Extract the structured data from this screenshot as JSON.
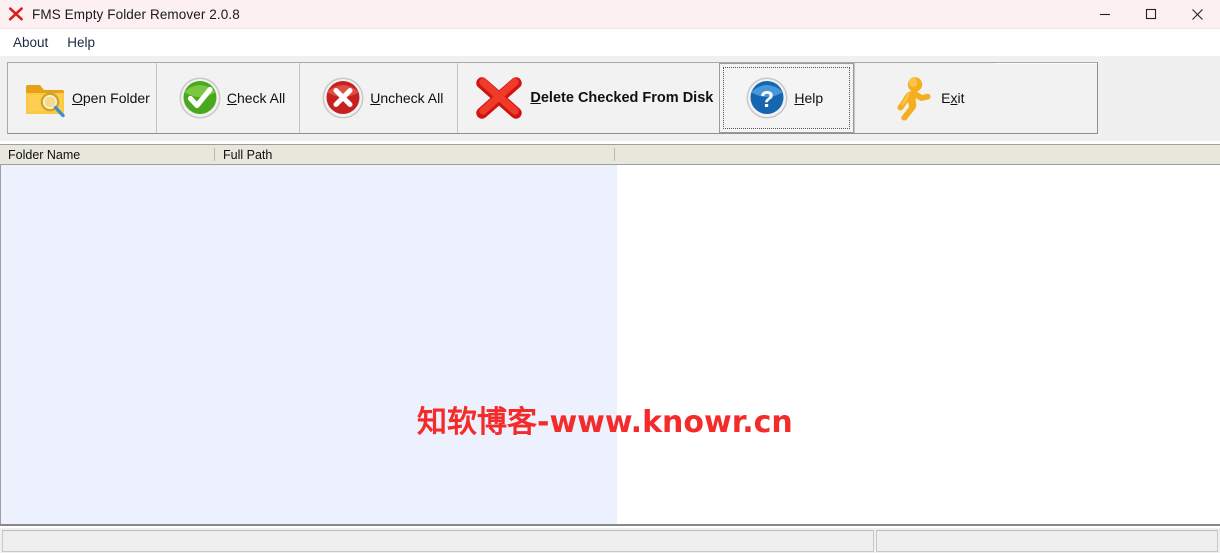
{
  "window": {
    "title": "FMS Empty Folder Remover 2.0.8",
    "icon": "red-x-icon",
    "titlebar_color": "#fcf0f2",
    "controls": [
      {
        "name": "minimize-button",
        "glyph": "minimize"
      },
      {
        "name": "maximize-button",
        "glyph": "maximize"
      },
      {
        "name": "close-button",
        "glyph": "close"
      }
    ]
  },
  "menubar": {
    "items": [
      {
        "label": "About",
        "name": "menu-item-about"
      },
      {
        "label": "Help",
        "name": "menu-item-help"
      }
    ]
  },
  "toolbar": {
    "buttons": [
      {
        "name": "open-folder-button",
        "icon": "folder-search-icon",
        "label_pre": "",
        "accel": "O",
        "label_post": "pen Folder",
        "bold": false,
        "focused": false
      },
      {
        "name": "check-all-button",
        "icon": "green-check-circle-icon",
        "label_pre": "",
        "accel": "C",
        "label_post": "heck All",
        "bold": false,
        "focused": false
      },
      {
        "name": "uncheck-all-button",
        "icon": "red-x-circle-icon",
        "label_pre": "",
        "accel": "U",
        "label_post": "ncheck All",
        "bold": false,
        "focused": false
      },
      {
        "name": "delete-checked-from-disk-button",
        "icon": "red-cross-icon",
        "label_pre": "",
        "accel": "D",
        "label_post": "elete Checked From Disk",
        "bold": true,
        "focused": false
      },
      {
        "name": "help-button",
        "icon": "blue-question-circle-icon",
        "label_pre": "",
        "accel": "H",
        "label_post": "elp",
        "bold": false,
        "focused": true
      },
      {
        "name": "exit-button",
        "icon": "running-man-icon",
        "label_pre": "E",
        "accel": "x",
        "label_post": "it",
        "bold": false,
        "focused": false
      }
    ]
  },
  "list": {
    "columns": [
      {
        "label": "Folder Name",
        "name": "column-header-folder-name"
      },
      {
        "label": "Full Path",
        "name": "column-header-full-path"
      },
      {
        "label": "",
        "name": "column-header-extra"
      }
    ],
    "rows": [],
    "empty_row_color": "#edf0fd",
    "background_color": "#ffffff"
  },
  "watermark": {
    "text": "知软博客-www.knowr.cn",
    "color": "#f42b2b"
  },
  "statusbar": {
    "panels": [
      {
        "text": "",
        "name": "status-panel-left"
      },
      {
        "text": "",
        "name": "status-panel-right"
      }
    ]
  }
}
